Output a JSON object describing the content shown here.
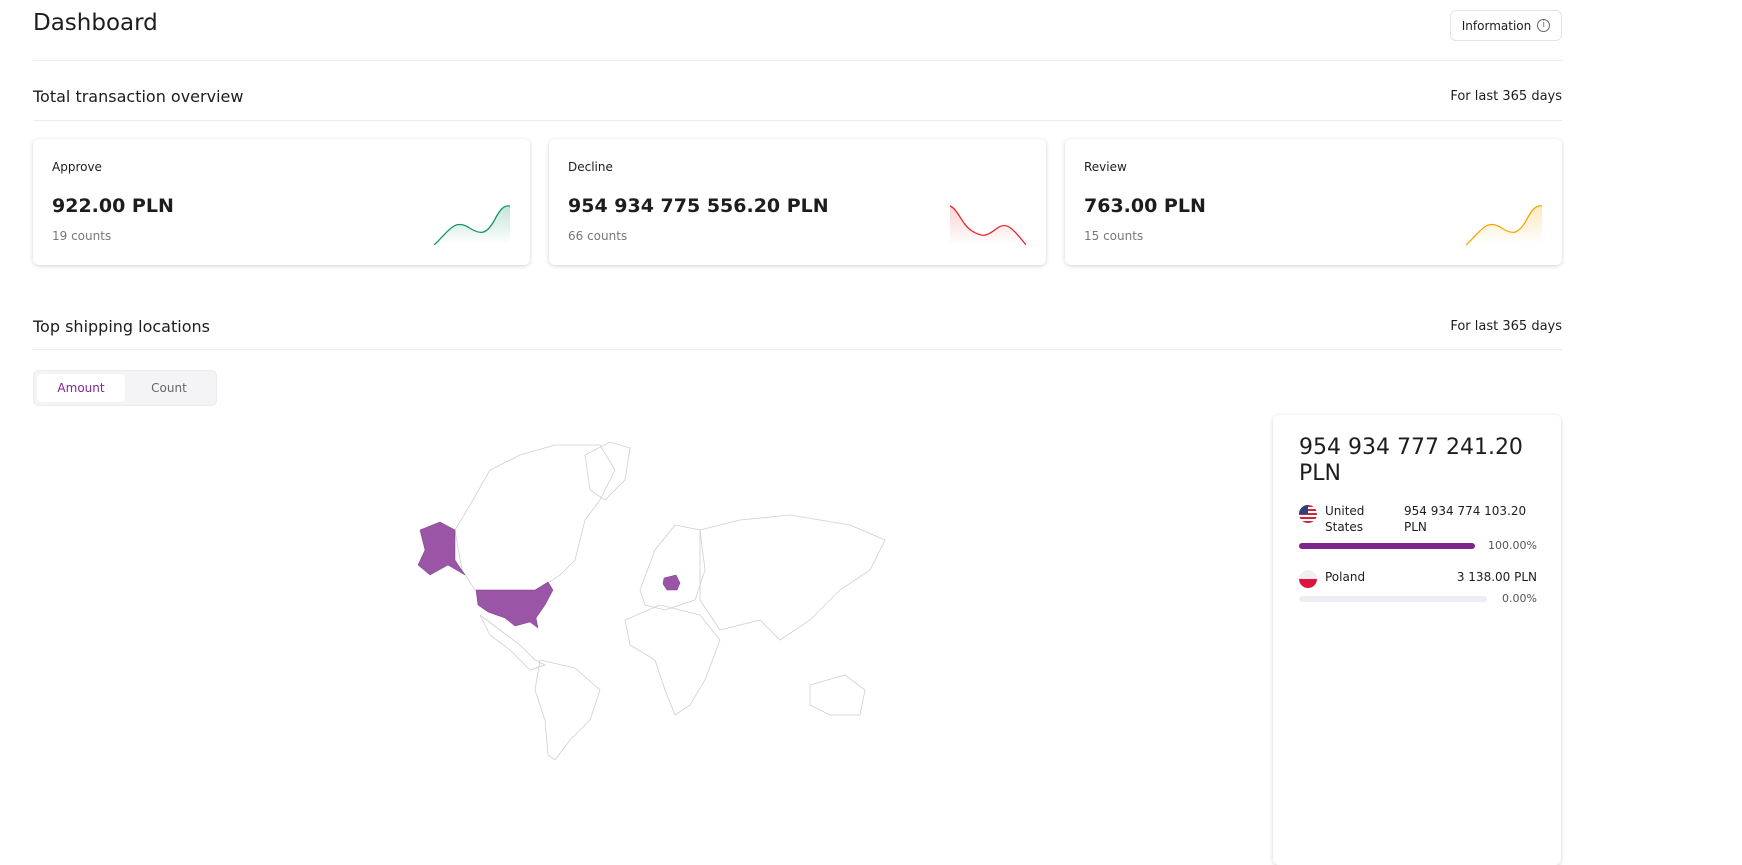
{
  "header": {
    "title": "Dashboard",
    "info_label": "Information"
  },
  "overview": {
    "title": "Total transaction overview",
    "period": "For last 365 days",
    "cards": [
      {
        "label": "Approve",
        "value": "922.00 PLN",
        "count": "19 counts",
        "color": "#12956b"
      },
      {
        "label": "Decline",
        "value": "954 934 775 556.20 PLN",
        "count": "66 counts",
        "color": "#e8242a"
      },
      {
        "label": "Review",
        "value": "763.00 PLN",
        "count": "15 counts",
        "color": "#f5a800"
      }
    ]
  },
  "shipping": {
    "title": "Top shipping locations",
    "period": "For last 365 days",
    "tabs": [
      {
        "label": "Amount",
        "active": true
      },
      {
        "label": "Count",
        "active": false
      }
    ],
    "total": "954 934 777 241.20 PLN",
    "countries": [
      {
        "name": "United States",
        "amount": "954 934 774 103.20 PLN",
        "percent": "100.00%",
        "fraction": 1.0
      },
      {
        "name": "Poland",
        "amount": "3 138.00 PLN",
        "percent": "0.00%",
        "fraction": 0.0
      }
    ],
    "highlight_color": "#9b55a6"
  }
}
